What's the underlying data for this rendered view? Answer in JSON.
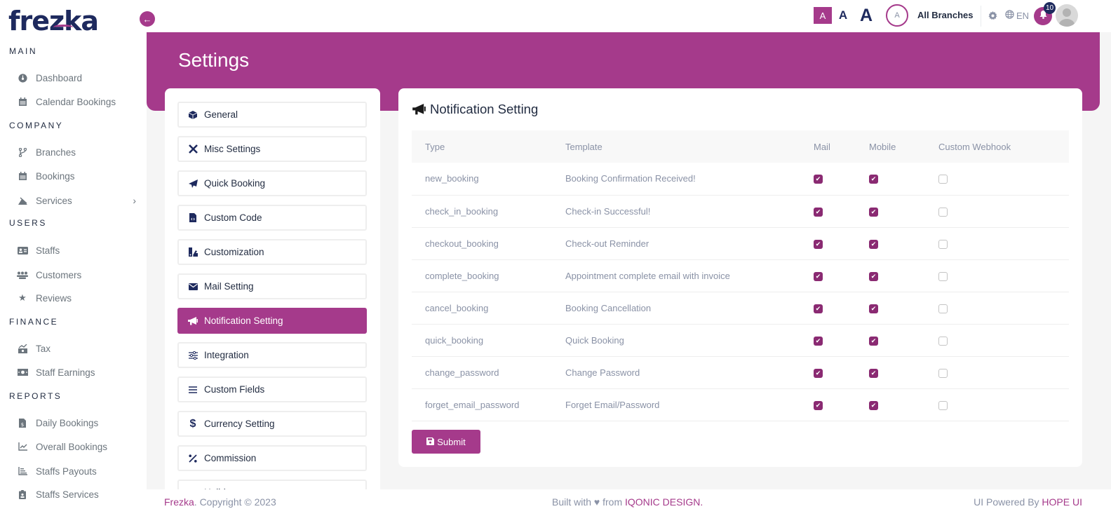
{
  "brand": {
    "logo": "frezka",
    "accent_color": "#a53a8b",
    "navy_color": "#1e2a5e"
  },
  "sidebar": {
    "sections": [
      {
        "title": "MAIN",
        "items": [
          {
            "label": "Dashboard",
            "icon": "dashboard-gauge-icon"
          },
          {
            "label": "Calendar Bookings",
            "icon": "calendar-icon"
          }
        ]
      },
      {
        "title": "COMPANY",
        "items": [
          {
            "label": "Branches",
            "icon": "code-branch-icon"
          },
          {
            "label": "Bookings",
            "icon": "calendar-icon"
          },
          {
            "label": "Services",
            "icon": "scissors-service-icon",
            "has_submenu": true
          }
        ]
      },
      {
        "title": "USERS",
        "items": [
          {
            "label": "Staffs",
            "icon": "id-card-icon"
          },
          {
            "label": "Customers",
            "icon": "users-icon"
          },
          {
            "label": "Reviews",
            "icon": "star-icon"
          }
        ]
      },
      {
        "title": "FINANCE",
        "items": [
          {
            "label": "Tax",
            "icon": "money-chart-icon"
          },
          {
            "label": "Staff Earnings",
            "icon": "money-bill-icon"
          }
        ]
      },
      {
        "title": "REPORTS",
        "items": [
          {
            "label": "Daily Bookings",
            "icon": "file-invoice-dollar-icon"
          },
          {
            "label": "Overall Bookings",
            "icon": "chart-line-icon"
          },
          {
            "label": "Staffs Payouts",
            "icon": "chart-bar-icon"
          },
          {
            "label": "Staffs Services",
            "icon": "clipboard-user-icon"
          }
        ]
      }
    ]
  },
  "topbar": {
    "font_size_options": [
      "A",
      "A",
      "A"
    ],
    "branch_avatar": "A",
    "branch_label": "All Branches",
    "language": "EN",
    "notification_count": "10"
  },
  "page": {
    "title": "Settings"
  },
  "settings_menu": {
    "items": [
      {
        "label": "General",
        "icon": "cube-icon"
      },
      {
        "label": "Misc Settings",
        "icon": "tools-icon"
      },
      {
        "label": "Quick Booking",
        "icon": "paper-plane-icon"
      },
      {
        "label": "Custom Code",
        "icon": "file-code-icon"
      },
      {
        "label": "Customization",
        "icon": "swatchbook-icon"
      },
      {
        "label": "Mail Setting",
        "icon": "envelope-icon"
      },
      {
        "label": "Notification Setting",
        "icon": "bullhorn-icon",
        "active": true
      },
      {
        "label": "Integration",
        "icon": "sliders-icon"
      },
      {
        "label": "Custom Fields",
        "icon": "bars-icon"
      },
      {
        "label": "Currency Setting",
        "icon": "dollar-icon"
      },
      {
        "label": "Commission",
        "icon": "percent-icon"
      },
      {
        "label": "Holidays",
        "icon": "calendar-icon"
      }
    ]
  },
  "notification_setting": {
    "title": "Notification Setting",
    "columns": [
      "Type",
      "Template",
      "Mail",
      "Mobile",
      "Custom Webhook"
    ],
    "rows": [
      {
        "type": "new_booking",
        "template": "Booking Confirmation Received!",
        "mail": true,
        "mobile": true,
        "webhook": false
      },
      {
        "type": "check_in_booking",
        "template": "Check-in Successful!",
        "mail": true,
        "mobile": true,
        "webhook": false
      },
      {
        "type": "checkout_booking",
        "template": "Check-out Reminder",
        "mail": true,
        "mobile": true,
        "webhook": false
      },
      {
        "type": "complete_booking",
        "template": "Appointment complete email with invoice",
        "mail": true,
        "mobile": true,
        "webhook": false
      },
      {
        "type": "cancel_booking",
        "template": "Booking Cancellation",
        "mail": true,
        "mobile": true,
        "webhook": false
      },
      {
        "type": "quick_booking",
        "template": "Quick Booking",
        "mail": true,
        "mobile": true,
        "webhook": false
      },
      {
        "type": "change_password",
        "template": "Change Password",
        "mail": true,
        "mobile": true,
        "webhook": false
      },
      {
        "type": "forget_email_password",
        "template": "Forget Email/Password",
        "mail": true,
        "mobile": true,
        "webhook": false
      }
    ],
    "submit_label": "Submit"
  },
  "footer": {
    "brand": "Frezka",
    "copyright": ". Copyright © 2023",
    "built_with": "Built with ♥ from ",
    "built_by": "IQONIC DESIGN.",
    "powered_by": "UI Powered By ",
    "powered_name": "HOPE UI"
  }
}
